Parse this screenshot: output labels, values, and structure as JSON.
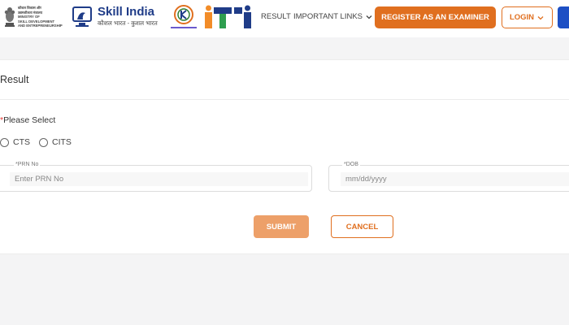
{
  "header": {
    "ministry_lines": [
      "कौशल विकास और",
      "उद्यमशीलता मंत्रालय",
      "MINISTRY OF",
      "SKILL DEVELOPMENT",
      "AND ENTREPRENEURSHIP"
    ],
    "skill_india": {
      "main": "Skill India",
      "sub": "कौशल भारत - कुशल भारत"
    },
    "nav": {
      "result": "RESULT",
      "important_links": "IMPORTANT LINKS"
    },
    "register_button": "REGISTER AS AN EXAMINER",
    "login_button": "LOGIN",
    "colors": {
      "accent": "#e06f1f",
      "brand_blue": "#1f3c88",
      "edge_button": "#1d4fc4"
    }
  },
  "form": {
    "title": "Result",
    "please_select_required": "*",
    "please_select": "Please Select",
    "options": [
      {
        "label": "CTS",
        "checked": false
      },
      {
        "label": "CITS",
        "checked": false
      }
    ],
    "prn": {
      "label": "*PRN No",
      "placeholder": "Enter PRN No",
      "value": ""
    },
    "dob": {
      "label": "*DOB",
      "placeholder": "mm/dd/yyyy",
      "value": ""
    },
    "submit_button": "SUBMIT",
    "cancel_button": "CANCEL"
  }
}
